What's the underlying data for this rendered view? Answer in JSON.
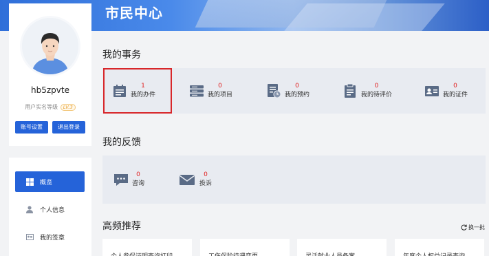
{
  "banner": {
    "title": "市民中心"
  },
  "profile": {
    "username": "hb5zpvte",
    "level_label": "用户实名等级",
    "level_badge": "LV.3",
    "settings_button": "账号设置",
    "logout_button": "退出登录"
  },
  "nav": {
    "items": [
      {
        "label": "概览",
        "icon": "grid-icon",
        "active": true
      },
      {
        "label": "个人信息",
        "icon": "person-icon",
        "active": false
      },
      {
        "label": "我的签章",
        "icon": "id-card-icon",
        "active": false
      }
    ]
  },
  "my_affairs": {
    "title": "我的事务",
    "items": [
      {
        "count": "1",
        "label": "我的办件",
        "icon": "calendar-doc-icon"
      },
      {
        "count": "0",
        "label": "我的项目",
        "icon": "server-stack-icon"
      },
      {
        "count": "0",
        "label": "我的预约",
        "icon": "doc-clock-icon"
      },
      {
        "count": "0",
        "label": "我的待评价",
        "icon": "clipboard-icon"
      },
      {
        "count": "0",
        "label": "我的证件",
        "icon": "id-card-icon"
      }
    ]
  },
  "my_feedback": {
    "title": "我的反馈",
    "items": [
      {
        "count": "0",
        "label": "咨询",
        "icon": "chat-bubble-icon"
      },
      {
        "count": "0",
        "label": "投诉",
        "icon": "mail-icon"
      }
    ]
  },
  "recommend": {
    "title": "高频推荐",
    "refresh_label": "换一批",
    "cards": [
      "个人参保证明查询打印",
      "工伤保险待遇变更",
      "灵活就业人员备案",
      "年度个人权益记录查询"
    ]
  },
  "colors": {
    "primary": "#2563d9",
    "count_red": "#e02020",
    "highlight_border": "#d8262a",
    "icon_slate": "#5a6b86"
  }
}
